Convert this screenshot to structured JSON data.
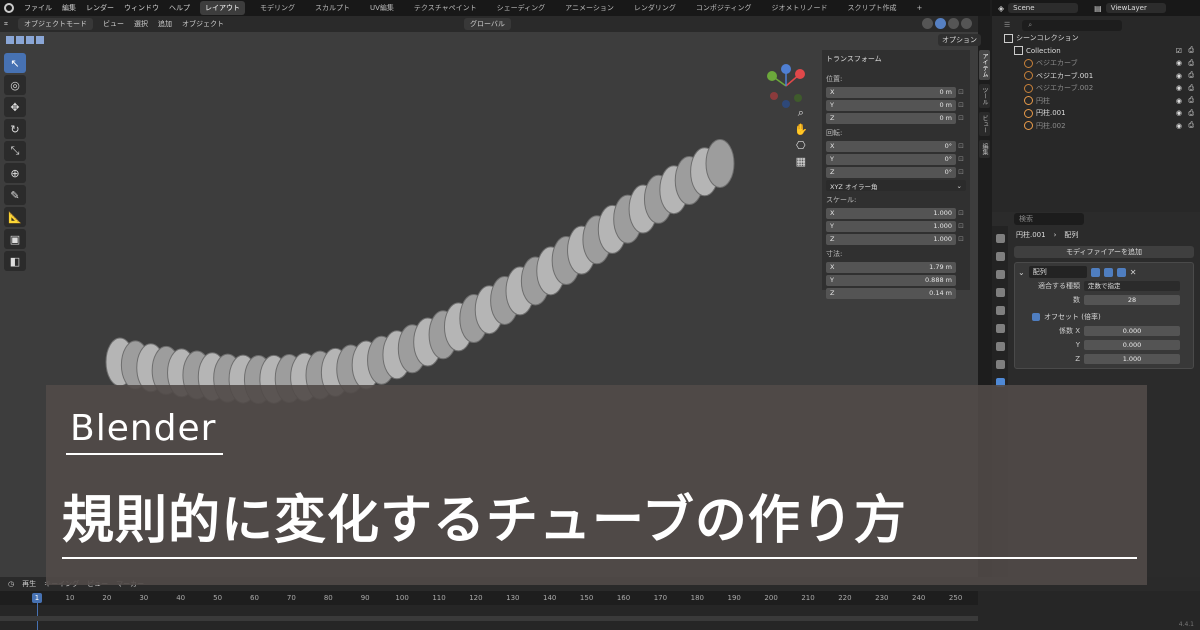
{
  "menu": {
    "items": [
      "ファイル",
      "編集",
      "レンダー",
      "ウィンドウ",
      "ヘルプ"
    ]
  },
  "workspaces": [
    "レイアウト",
    "モデリング",
    "スカルプト",
    "UV編集",
    "テクスチャペイント",
    "シェーディング",
    "アニメーション",
    "レンダリング",
    "コンポジティング",
    "ジオメトリノード",
    "スクリプト作成",
    "+"
  ],
  "viewport_header": {
    "mode": "オブジェクトモード",
    "items": [
      "ビュー",
      "選択",
      "追加",
      "オブジェクト"
    ],
    "transform_orientation": "グローバル",
    "options": "オプション"
  },
  "npanel": {
    "title": "トランスフォーム",
    "location_label": "位置:",
    "location": [
      {
        "axis": "X",
        "value": "0 m"
      },
      {
        "axis": "Y",
        "value": "0 m"
      },
      {
        "axis": "Z",
        "value": "0 m"
      }
    ],
    "rotation_label": "回転:",
    "rotation": [
      {
        "axis": "X",
        "value": "0°"
      },
      {
        "axis": "Y",
        "value": "0°"
      },
      {
        "axis": "Z",
        "value": "0°"
      }
    ],
    "rotation_mode": "XYZ オイラー角",
    "scale_label": "スケール:",
    "scale": [
      {
        "axis": "X",
        "value": "1.000"
      },
      {
        "axis": "Y",
        "value": "1.000"
      },
      {
        "axis": "Z",
        "value": "1.000"
      }
    ],
    "dimensions_label": "寸法:",
    "dimensions": [
      {
        "axis": "X",
        "value": "1.79 m"
      },
      {
        "axis": "Y",
        "value": "0.888 m"
      },
      {
        "axis": "Z",
        "value": "0.14 m"
      }
    ]
  },
  "side_tabs": [
    "アイテム",
    "ツール",
    "ビュー",
    "編集"
  ],
  "outliner": {
    "scene": "Scene",
    "view_layer": "ViewLayer",
    "root": "シーンコレクション",
    "collection": "Collection",
    "items": [
      {
        "name": "ベジエカーブ",
        "color": "#c7813a",
        "dim": true
      },
      {
        "name": "ベジエカーブ.001",
        "color": "#c7813a",
        "dim": false
      },
      {
        "name": "ベジエカーブ.002",
        "color": "#c7813a",
        "dim": true
      },
      {
        "name": "円柱",
        "color": "#e79a4a",
        "dim": true
      },
      {
        "name": "円柱.001",
        "color": "#e79a4a",
        "dim": false
      },
      {
        "name": "円柱.002",
        "color": "#e79a4a",
        "dim": true
      }
    ]
  },
  "properties": {
    "search_placeholder": "検索",
    "object": "円柱.001",
    "modifier_tab": "配列",
    "add_modifier": "モディファイアーを追加",
    "modifier_name": "配列",
    "fit_type_label": "適合する種類",
    "fit_type": "定数で指定",
    "count_label": "数",
    "count": "28",
    "offset_label": "オフセット (倍率)",
    "factor_x_label": "係数 X",
    "factor_x": "0.000",
    "factor_y_label": "Y",
    "factor_y": "0.000",
    "factor_z_label": "Z",
    "factor_z": "1.000"
  },
  "timeline": {
    "header": [
      "再生",
      "キーイング",
      "ビュー",
      "マーカー"
    ],
    "current_frame": "1",
    "ticks": [
      "10",
      "20",
      "30",
      "40",
      "50",
      "60",
      "70",
      "80",
      "90",
      "100",
      "110",
      "120",
      "130",
      "140",
      "150",
      "160",
      "170",
      "180",
      "190",
      "200",
      "210",
      "220",
      "230",
      "240",
      "250"
    ],
    "version": "4.4.1"
  },
  "overlay": {
    "subtitle": "Blender",
    "title": "規則的に変化するチューブの作り方"
  }
}
